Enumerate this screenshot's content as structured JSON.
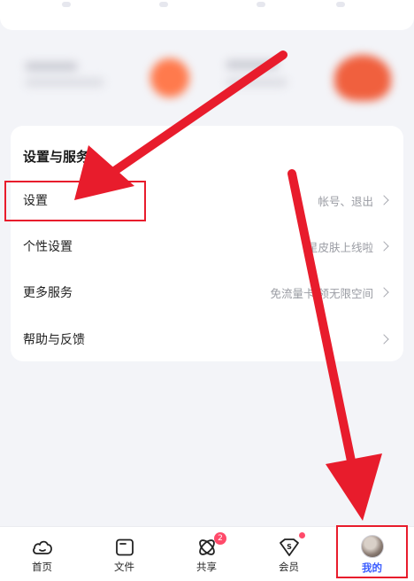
{
  "settings_card": {
    "title": "设置与服务",
    "rows": [
      {
        "label": "设置",
        "sub": "帐号、退出"
      },
      {
        "label": "个性设置",
        "sub": "星皮肤上线啦"
      },
      {
        "label": "更多服务",
        "sub": "免流量卡 领无限空间"
      },
      {
        "label": "帮助与反馈",
        "sub": ""
      }
    ]
  },
  "tabbar": {
    "tabs": [
      {
        "label": "首页",
        "icon": "home-cloud-icon"
      },
      {
        "label": "文件",
        "icon": "folder-icon"
      },
      {
        "label": "共享",
        "icon": "share-orbit-icon",
        "badge": "2"
      },
      {
        "label": "会员",
        "icon": "vip-shield-icon"
      },
      {
        "label": "我的",
        "icon": "avatar"
      }
    ],
    "active_tab": "我的"
  },
  "colors": {
    "accent": "#3a5cff",
    "badge": "#ff4a6a",
    "annotation_red": "#e81c2c",
    "background": "#f3f4f8"
  }
}
